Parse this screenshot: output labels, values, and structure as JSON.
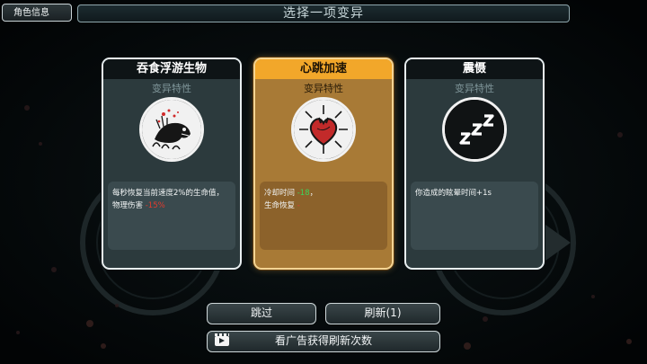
{
  "header": {
    "character_info_label": "角色信息",
    "title": "选择一项变异"
  },
  "cards": [
    {
      "title": "吞食浮游生物",
      "subtitle": "变异特性",
      "art_icon": "fish-creature-icon",
      "desc_line1": "每秒恢复当前速度2%的生命值，",
      "desc_line2_prefix": "物理伤害",
      "desc_line2_value": "-15%",
      "selected": false
    },
    {
      "title": "心跳加速",
      "subtitle": "变异特性",
      "art_icon": "heart-icon",
      "desc_line1_prefix": "冷却时间",
      "desc_line1_value": "-18",
      "desc_line1_suffix": "，",
      "desc_line2_prefix": "生命恢复",
      "desc_line2_value": "-",
      "selected": true
    },
    {
      "title": "震慑",
      "subtitle": "变异特性",
      "art_icon": "sleep-zzz-icon",
      "desc_line1": "你造成的眩晕时间+1s",
      "selected": false
    }
  ],
  "buttons": {
    "skip_label": "跳过",
    "refresh_label": "刷新(1)",
    "ad_refresh_label": "看广告获得刷新次数"
  },
  "colors": {
    "selected_border": "#f4d493",
    "selected_title_bg": "#f2a72a",
    "negative_value": "#e23b2e",
    "positive_value": "#3ed35a"
  }
}
